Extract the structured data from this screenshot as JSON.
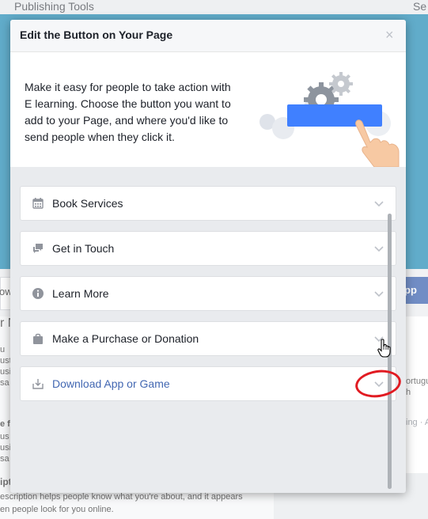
{
  "background": {
    "top_left_label": "Publishing Tools",
    "top_right_label": "Se",
    "left_card_label": "ow",
    "cta_fragment": "pp",
    "left_fragments": [
      "r N",
      "u",
      "ust",
      "usi",
      "sa",
      "e fo",
      "us",
      "usi",
      "sa",
      "ipt"
    ],
    "right_fragments": [
      "ortugu",
      "h",
      "ing · A"
    ],
    "about_line1": "escription helps people know what you're about, and it appears",
    "about_line2": "en people look for you online."
  },
  "modal": {
    "title": "Edit the Button on Your Page",
    "close_label": "×",
    "intro": "Make it easy for people to take action with E learning. Choose the button you want to add to your Page, and where you'd like to send people when they click it.",
    "accent_color": "#4080ff",
    "options": [
      {
        "label": "Book Services",
        "icon": "calendar-icon"
      },
      {
        "label": "Get in Touch",
        "icon": "chat-bubbles-icon"
      },
      {
        "label": "Learn More",
        "icon": "info-icon"
      },
      {
        "label": "Make a Purchase or Donation",
        "icon": "shopping-bag-icon"
      },
      {
        "label": "Download App or Game",
        "icon": "download-icon",
        "highlighted": true
      }
    ]
  },
  "annotation": {
    "color": "#e11b22"
  }
}
